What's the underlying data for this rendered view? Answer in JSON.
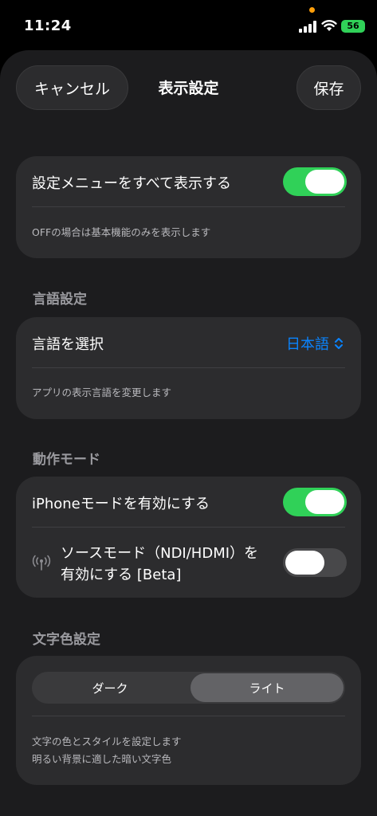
{
  "status": {
    "time": "11:24",
    "battery": "56"
  },
  "nav": {
    "cancel_label": "キャンセル",
    "title": "表示設定",
    "save_label": "保存"
  },
  "show_all": {
    "label": "設定メニューをすべて表示する",
    "enabled": true,
    "description": "OFFの場合は基本機能のみを表示します"
  },
  "language": {
    "section_title": "言語設定",
    "label": "言語を選択",
    "value": "日本語",
    "description": "アプリの表示言語を変更します"
  },
  "mode": {
    "section_title": "動作モード",
    "iphone_mode_label": "iPhoneモードを有効にする",
    "iphone_mode_enabled": true,
    "source_mode_line1": "ソースモード（NDI/HDMI）を",
    "source_mode_line2": "有効にする [Beta]",
    "source_mode_enabled": false
  },
  "text_color": {
    "section_title": "文字色設定",
    "options": [
      "ダーク",
      "ライト"
    ],
    "selected": "ライト",
    "description_line1": "文字の色とスタイルを設定します",
    "description_line2": "明るい背景に適した暗い文字色"
  },
  "colors": {
    "accent_blue": "#0a84ff",
    "toggle_green": "#30d158",
    "background": "#1c1c1e",
    "card": "#2c2c2e"
  },
  "icons": {
    "signal": "cellular-signal-icon",
    "wifi": "wifi-icon",
    "battery": "battery-charging-icon",
    "antenna": "antenna-broadcast-icon",
    "chevron": "chevron-up-down-icon"
  }
}
